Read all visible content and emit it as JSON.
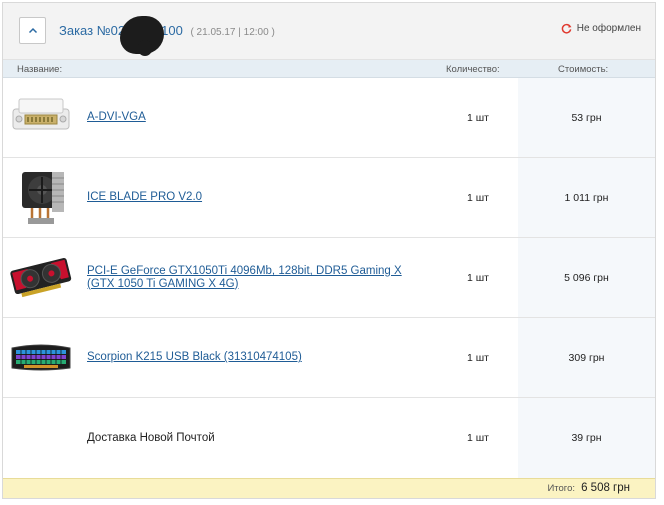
{
  "order": {
    "title_prefix": "Заказ №02",
    "title_suffix": "100",
    "date": "( 21.05.17 | 12:00 )",
    "status": "Не оформлен"
  },
  "columns": {
    "name": "Название:",
    "quantity": "Количество:",
    "price": "Стоимость:"
  },
  "items": [
    {
      "name": "A-DVI-VGA",
      "qty": "1 шт",
      "price": "53 грн",
      "image": "dvi-vga-adapter",
      "link": true
    },
    {
      "name": "ICE BLADE PRO V2.0",
      "qty": "1 шт",
      "price": "1 011 грн",
      "image": "cpu-cooler",
      "link": true
    },
    {
      "name": "PCI-E GeForce GTX1050Ti 4096Mb, 128bit, DDR5 Gaming X (GTX 1050 Ti GAMING X 4G)",
      "qty": "1 шт",
      "price": "5 096 грн",
      "image": "graphics-card",
      "link": true
    },
    {
      "name": "Scorpion K215 USB Black (31310474105)",
      "qty": "1 шт",
      "price": "309 грн",
      "image": "keyboard",
      "link": true
    },
    {
      "name": "Доставка Новой Почтой",
      "qty": "1 шт",
      "price": "39 грн",
      "image": "",
      "link": false
    }
  ],
  "total": {
    "label": "Итого:",
    "value": "6 508 грн"
  },
  "colors": {
    "link": "#1f5c96",
    "status_icon": "#e03a2f",
    "total_bg": "#fbf3c2",
    "header_bg": "#f3f3f3",
    "column_head_bg": "#e6eef4"
  }
}
